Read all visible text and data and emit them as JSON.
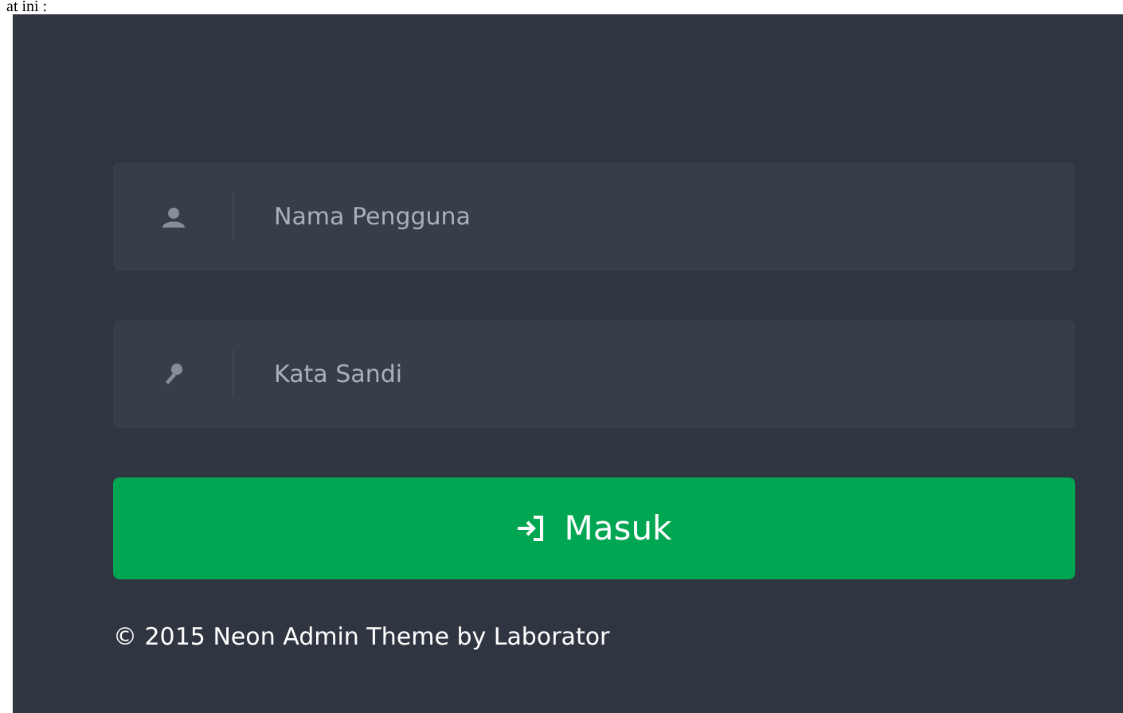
{
  "caption": "at ini :",
  "fields": [
    {
      "kind": "user",
      "placeholder": "Nama Pengguna"
    },
    {
      "kind": "key",
      "placeholder": "Kata Sandi"
    }
  ],
  "login_button": {
    "label": "Masuk"
  },
  "footer": "© 2015 Neon Admin Theme by Laborator"
}
